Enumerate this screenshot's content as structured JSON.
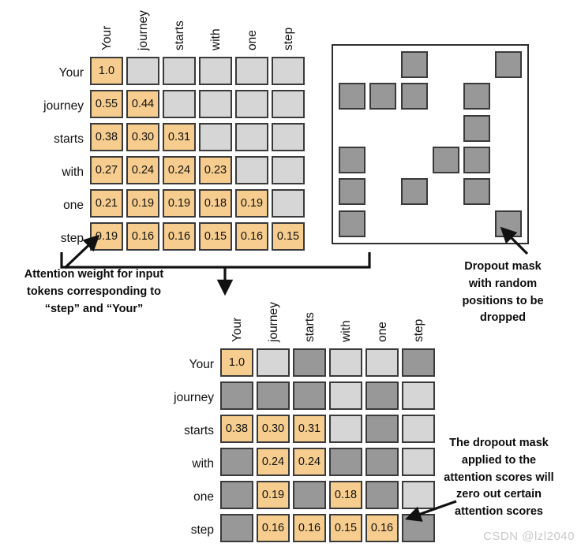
{
  "tokens": [
    "Your",
    "journey",
    "starts",
    "with",
    "one",
    "step"
  ],
  "colors": {
    "orange": "#f6cd8e",
    "light_gray": "#d6d6d6",
    "dark_gray": "#989898",
    "border": "#3a3a3a",
    "watermark": "#c9c9c9"
  },
  "attention_matrix": {
    "title": "",
    "row_labels": [
      "Your",
      "journey",
      "starts",
      "with",
      "one",
      "step"
    ],
    "col_labels": [
      "Your",
      "journey",
      "starts",
      "with",
      "one",
      "step"
    ],
    "rows": [
      [
        {
          "v": "1.0",
          "s": "orange"
        },
        {
          "v": "",
          "s": "lgray"
        },
        {
          "v": "",
          "s": "lgray"
        },
        {
          "v": "",
          "s": "lgray"
        },
        {
          "v": "",
          "s": "lgray"
        },
        {
          "v": "",
          "s": "lgray"
        }
      ],
      [
        {
          "v": "0.55",
          "s": "orange"
        },
        {
          "v": "0.44",
          "s": "orange"
        },
        {
          "v": "",
          "s": "lgray"
        },
        {
          "v": "",
          "s": "lgray"
        },
        {
          "v": "",
          "s": "lgray"
        },
        {
          "v": "",
          "s": "lgray"
        }
      ],
      [
        {
          "v": "0.38",
          "s": "orange"
        },
        {
          "v": "0.30",
          "s": "orange"
        },
        {
          "v": "0.31",
          "s": "orange"
        },
        {
          "v": "",
          "s": "lgray"
        },
        {
          "v": "",
          "s": "lgray"
        },
        {
          "v": "",
          "s": "lgray"
        }
      ],
      [
        {
          "v": "0.27",
          "s": "orange"
        },
        {
          "v": "0.24",
          "s": "orange"
        },
        {
          "v": "0.24",
          "s": "orange"
        },
        {
          "v": "0.23",
          "s": "orange"
        },
        {
          "v": "",
          "s": "lgray"
        },
        {
          "v": "",
          "s": "lgray"
        }
      ],
      [
        {
          "v": "0.21",
          "s": "orange"
        },
        {
          "v": "0.19",
          "s": "orange"
        },
        {
          "v": "0.19",
          "s": "orange"
        },
        {
          "v": "0.18",
          "s": "orange"
        },
        {
          "v": "0.19",
          "s": "orange"
        },
        {
          "v": "",
          "s": "lgray"
        }
      ],
      [
        {
          "v": "0.19",
          "s": "orange"
        },
        {
          "v": "0.16",
          "s": "orange"
        },
        {
          "v": "0.16",
          "s": "orange"
        },
        {
          "v": "0.15",
          "s": "orange"
        },
        {
          "v": "0.16",
          "s": "orange"
        },
        {
          "v": "0.15",
          "s": "orange"
        }
      ]
    ]
  },
  "dropout_mask": {
    "rows": [
      [
        0,
        0,
        1,
        0,
        0,
        1
      ],
      [
        1,
        1,
        1,
        0,
        1,
        0
      ],
      [
        0,
        0,
        0,
        0,
        1,
        0
      ],
      [
        1,
        0,
        0,
        1,
        1,
        0
      ],
      [
        1,
        0,
        1,
        0,
        1,
        0
      ],
      [
        1,
        0,
        0,
        0,
        0,
        1
      ]
    ]
  },
  "masked_matrix": {
    "row_labels": [
      "Your",
      "journey",
      "starts",
      "with",
      "one",
      "step"
    ],
    "col_labels": [
      "Your",
      "journey",
      "starts",
      "with",
      "one",
      "step"
    ],
    "rows": [
      [
        {
          "v": "1.0",
          "s": "orange"
        },
        {
          "v": "",
          "s": "lgray"
        },
        {
          "v": "",
          "s": "dgray"
        },
        {
          "v": "",
          "s": "lgray"
        },
        {
          "v": "",
          "s": "lgray"
        },
        {
          "v": "",
          "s": "dgray"
        }
      ],
      [
        {
          "v": "",
          "s": "dgray"
        },
        {
          "v": "",
          "s": "dgray"
        },
        {
          "v": "",
          "s": "dgray"
        },
        {
          "v": "",
          "s": "lgray"
        },
        {
          "v": "",
          "s": "dgray"
        },
        {
          "v": "",
          "s": "lgray"
        }
      ],
      [
        {
          "v": "0.38",
          "s": "orange"
        },
        {
          "v": "0.30",
          "s": "orange"
        },
        {
          "v": "0.31",
          "s": "orange"
        },
        {
          "v": "",
          "s": "lgray"
        },
        {
          "v": "",
          "s": "dgray"
        },
        {
          "v": "",
          "s": "lgray"
        }
      ],
      [
        {
          "v": "",
          "s": "dgray"
        },
        {
          "v": "0.24",
          "s": "orange"
        },
        {
          "v": "0.24",
          "s": "orange"
        },
        {
          "v": "",
          "s": "dgray"
        },
        {
          "v": "",
          "s": "dgray"
        },
        {
          "v": "",
          "s": "lgray"
        }
      ],
      [
        {
          "v": "",
          "s": "dgray"
        },
        {
          "v": "0.19",
          "s": "orange"
        },
        {
          "v": "",
          "s": "dgray"
        },
        {
          "v": "0.18",
          "s": "orange"
        },
        {
          "v": "",
          "s": "dgray"
        },
        {
          "v": "",
          "s": "lgray"
        }
      ],
      [
        {
          "v": "",
          "s": "dgray"
        },
        {
          "v": "0.16",
          "s": "orange"
        },
        {
          "v": "0.16",
          "s": "orange"
        },
        {
          "v": "0.15",
          "s": "orange"
        },
        {
          "v": "0.16",
          "s": "orange"
        },
        {
          "v": "",
          "s": "dgray"
        }
      ]
    ]
  },
  "annotations": {
    "attention_weight_note": "Attention weight for input\ntokens corresponding to\n“step” and “Your”",
    "dropout_mask_note": "Dropout mask\nwith random\npositions to be\ndropped",
    "applied_note": "The dropout mask\napplied to the\nattention scores will\nzero out certain\nattention scores"
  },
  "watermark": "CSDN @lzl2040"
}
